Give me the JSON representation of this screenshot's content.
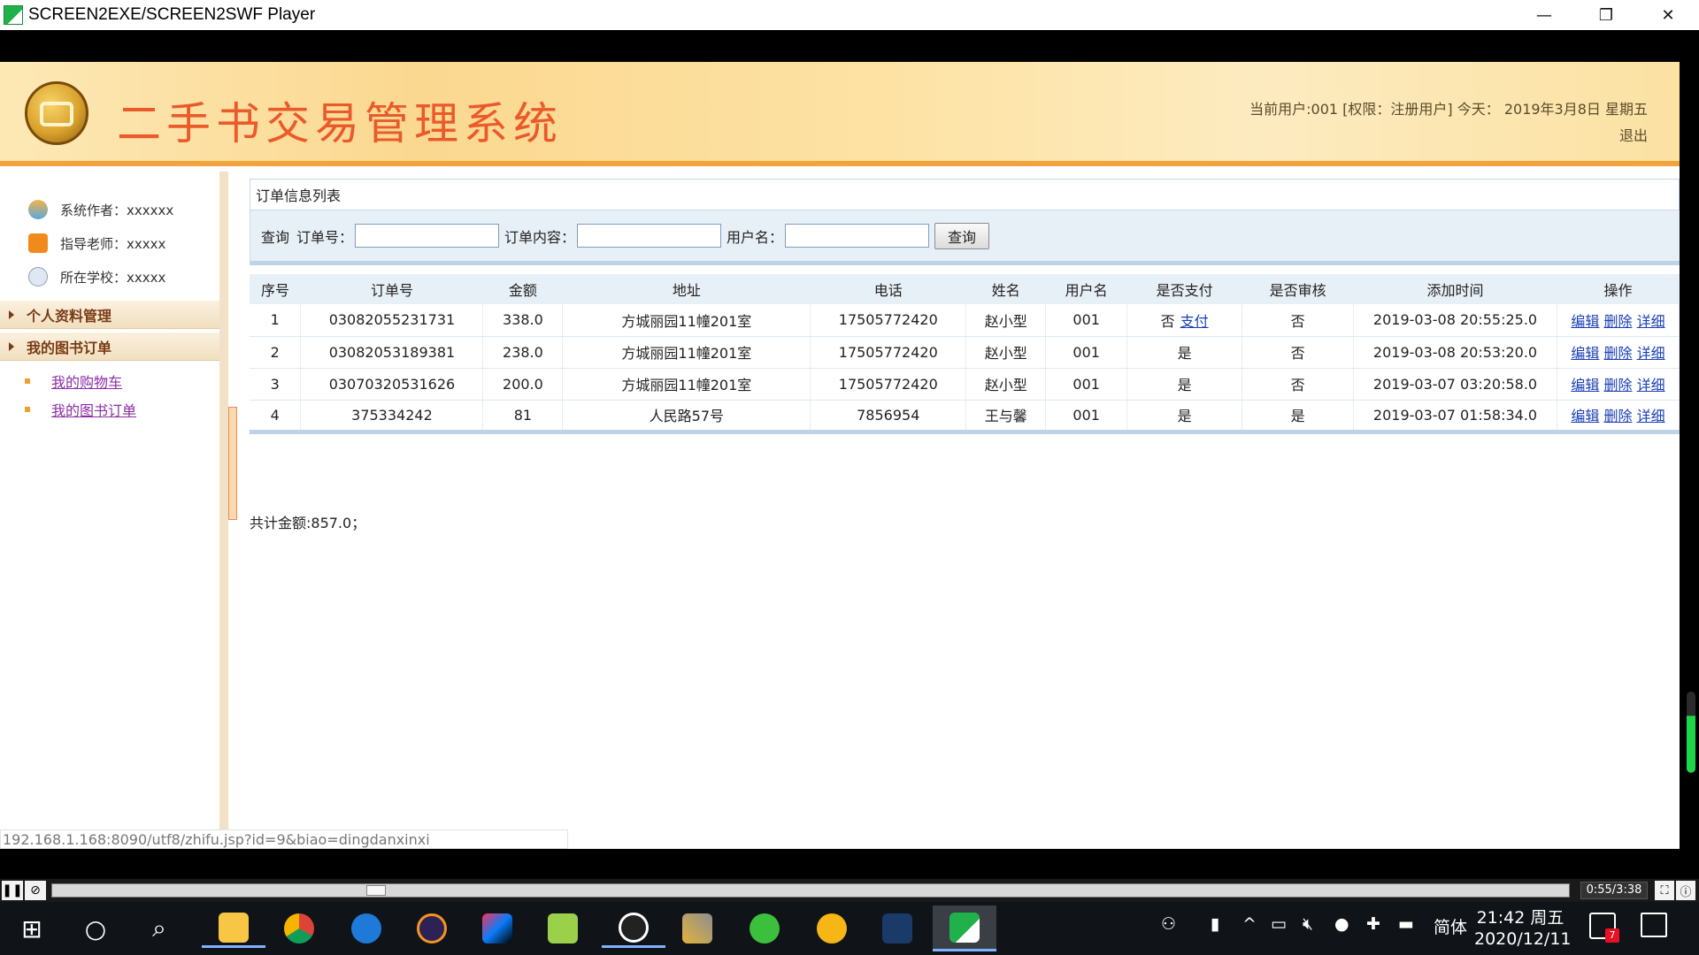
{
  "window": {
    "title": "SCREEN2EXE/SCREEN2SWF Player",
    "minimize_label": "—",
    "restore_label": "❐",
    "close_label": "✕"
  },
  "header": {
    "system_title": "二手书交易管理系统",
    "user_info": "当前用户:001 [权限：注册用户] 今天： 2019年3月8日 星期五",
    "logout": "退出"
  },
  "sidebar": {
    "info": [
      {
        "label": "系统作者：xxxxxx",
        "icon": "author-icon"
      },
      {
        "label": "指导老师：xxxxx",
        "icon": "teacher-icon"
      },
      {
        "label": "所在学校：xxxxx",
        "icon": "school-icon"
      }
    ],
    "menus": [
      {
        "label": "个人资料管理"
      },
      {
        "label": "我的图书订单"
      }
    ],
    "sub_items": [
      {
        "label": "我的购物车"
      },
      {
        "label": "我的图书订单"
      }
    ]
  },
  "panel": {
    "title": "订单信息列表",
    "search": {
      "query_label": "查询",
      "order_no_label": "订单号：",
      "order_content_label": "订单内容：",
      "username_label": "用户名：",
      "order_no_value": "",
      "order_content_value": "",
      "username_value": "",
      "button": "查询"
    },
    "columns": [
      "序号",
      "订单号",
      "金额",
      "地址",
      "电话",
      "姓名",
      "用户名",
      "是否支付",
      "是否审核",
      "添加时间",
      "操作"
    ],
    "rows": [
      {
        "no": "1",
        "order_no": "03082055231731",
        "amount": "338.0",
        "address": "方城丽园11幢201室",
        "phone": "17505772420",
        "name": "赵小型",
        "username": "001",
        "paid": "否",
        "pay_link": "支付",
        "reviewed": "否",
        "time": "2019-03-08 20:55:25.0"
      },
      {
        "no": "2",
        "order_no": "03082053189381",
        "amount": "238.0",
        "address": "方城丽园11幢201室",
        "phone": "17505772420",
        "name": "赵小型",
        "username": "001",
        "paid": "是",
        "pay_link": "",
        "reviewed": "否",
        "time": "2019-03-08 20:53:20.0"
      },
      {
        "no": "3",
        "order_no": "03070320531626",
        "amount": "200.0",
        "address": "方城丽园11幢201室",
        "phone": "17505772420",
        "name": "赵小型",
        "username": "001",
        "paid": "是",
        "pay_link": "",
        "reviewed": "否",
        "time": "2019-03-07 03:20:58.0"
      },
      {
        "no": "4",
        "order_no": "375334242",
        "amount": "81",
        "address": "人民路57号",
        "phone": "7856954",
        "name": "王与馨",
        "username": "001",
        "paid": "是",
        "pay_link": "",
        "reviewed": "是",
        "time": "2019-03-07 01:58:34.0"
      }
    ],
    "actions": {
      "edit": "编辑",
      "delete": "删除",
      "detail": "详细"
    },
    "total": "共计金额:857.0；"
  },
  "status_url": "192.168.1.168:8090/utf8/zhifu.jsp?id=9&biao=dingdanxinxi",
  "player": {
    "time": "0:55/3:38",
    "progress": 0.21
  },
  "taskbar": {
    "apps": [
      "windows-start-icon",
      "cortana-icon",
      "search-zoom-icon",
      "file-explorer-icon",
      "chrome-icon",
      "edge-icon",
      "eclipse-icon",
      "intellij-icon",
      "notepad-icon",
      "qq-icon",
      "tools-icon",
      "browser-green-icon",
      "sunflower-icon",
      "link-icon",
      "screen2exe-icon"
    ],
    "ime": "简体",
    "time": "21:42 周五",
    "date": "2020/12/11",
    "notifications": "7"
  }
}
